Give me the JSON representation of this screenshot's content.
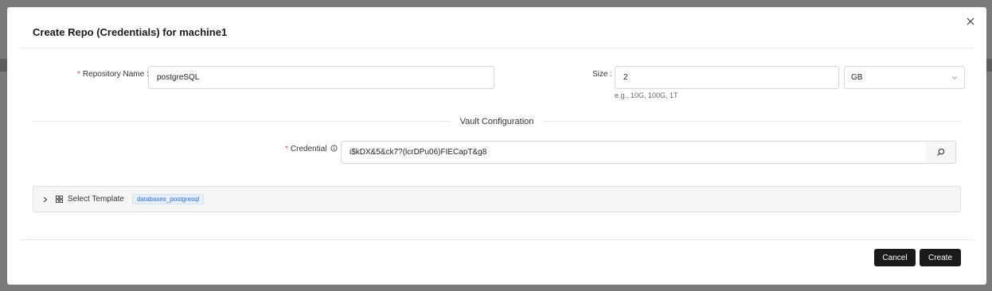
{
  "modal": {
    "title": "Create Repo (Credentials) for machine1"
  },
  "form": {
    "repository_name": {
      "required_mark": "*",
      "label": "Repository Name",
      "value": "postgreSQL"
    },
    "size": {
      "label": "Size",
      "value": "2",
      "hint": "e.g., 10G, 100G, 1T",
      "unit_selected": "GB"
    },
    "vault_section_title": "Vault Configuration",
    "credential": {
      "required_mark": "*",
      "label": "Credential",
      "value": "i$kDX&5&ck7?(lcrDPu06)FIECapT&g8"
    },
    "template": {
      "label": "Select Template",
      "tag": "databases_postgresql"
    }
  },
  "footer": {
    "cancel_label": "Cancel",
    "create_label": "Create"
  },
  "icons": {
    "close": "close-icon",
    "info": "info-circle-icon",
    "search": "search-icon",
    "chevron_down": "chevron-down-icon",
    "chevron_right": "chevron-right-icon",
    "grid": "grid-icon"
  }
}
